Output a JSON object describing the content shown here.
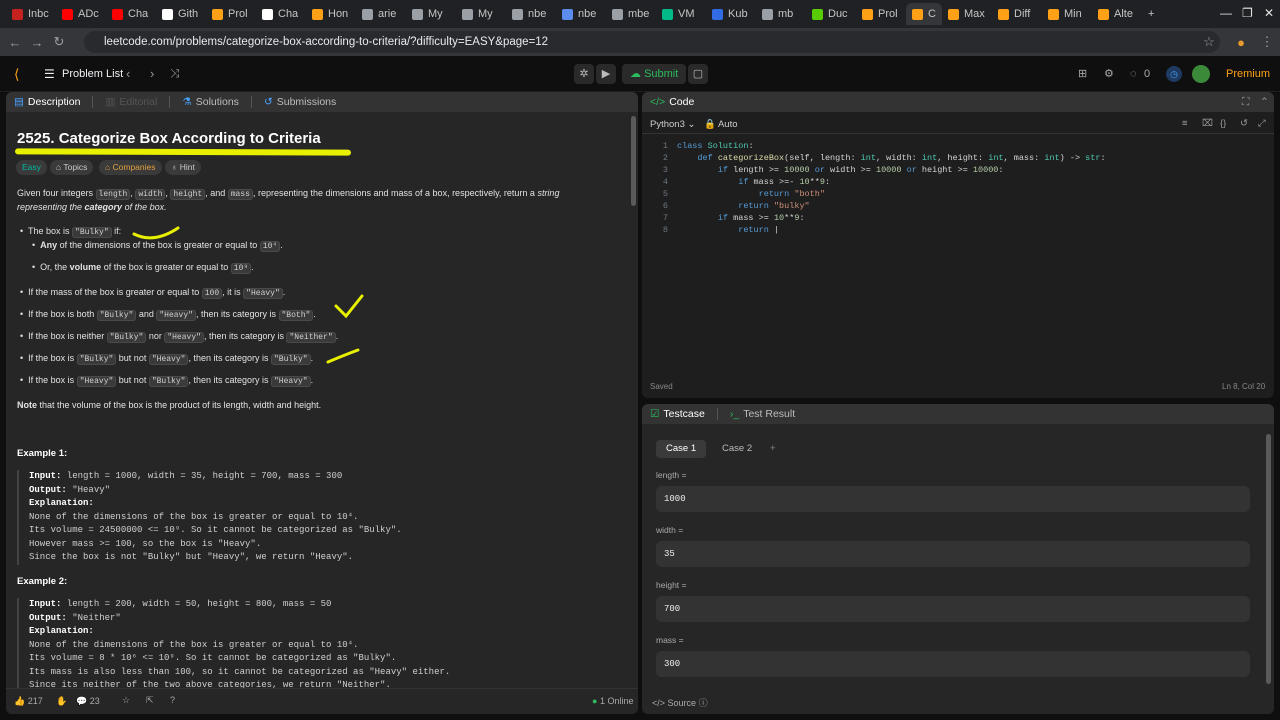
{
  "browser": {
    "tabs": [
      {
        "label": "Inbc",
        "color": "#c5221f"
      },
      {
        "label": "ADc",
        "color": "#ff0000"
      },
      {
        "label": "Cha",
        "color": "#ff0000"
      },
      {
        "label": "Gith",
        "color": "#ffffff"
      },
      {
        "label": "Prol",
        "color": "#ffa116"
      },
      {
        "label": "Cha",
        "color": "#ffffff"
      },
      {
        "label": "Hon",
        "color": "#ffa116"
      },
      {
        "label": "arie",
        "color": "#9aa0a6"
      },
      {
        "label": "My",
        "color": "#9aa0a6"
      },
      {
        "label": "My",
        "color": "#9aa0a6"
      },
      {
        "label": "nbe",
        "color": "#9aa0a6"
      },
      {
        "label": "nbe",
        "color": "#5b8def"
      },
      {
        "label": "mbe",
        "color": "#9aa0a6"
      },
      {
        "label": "VM",
        "color": "#0b8"
      },
      {
        "label": "Kub",
        "color": "#326ce5"
      },
      {
        "label": "mb",
        "color": "#9aa0a6"
      },
      {
        "label": "Duc",
        "color": "#58cc02"
      },
      {
        "label": "Prol",
        "color": "#ffa116"
      },
      {
        "label": "C",
        "color": "#ffa116"
      },
      {
        "label": "Max",
        "color": "#ffa116"
      },
      {
        "label": "Diff",
        "color": "#ffa116"
      },
      {
        "label": "Min",
        "color": "#ffa116"
      },
      {
        "label": "Alte",
        "color": "#ffa116"
      }
    ],
    "url": "leetcode.com/problems/categorize-box-according-to-criteria/?difficulty=EASY&page=12"
  },
  "nav": {
    "problem_list": "Problem List",
    "submit": "Submit",
    "streak": "0",
    "premium": "Premium"
  },
  "left": {
    "tabs": {
      "description": "Description",
      "editorial": "Editorial",
      "solutions": "Solutions",
      "submissions": "Submissions"
    },
    "title": "2525. Categorize Box According to Criteria",
    "chips": {
      "easy": "Easy",
      "topics": "Topics",
      "companies": "Companies",
      "hint": "Hint"
    },
    "intro": {
      "p1": "Given four integers ",
      "c1": "length",
      "s1": ", ",
      "c2": "width",
      "s2": ", ",
      "c3": "height",
      "s3": ", and ",
      "c4": "mass",
      "s4": ", representing the dimensions and mass of a box, respectively, return a ",
      "i1": "string",
      "line2a": "representing the ",
      "line2b": "category",
      "line2c": " of the box."
    },
    "rules": {
      "b1a": "The box is ",
      "b1c": "\"Bulky\"",
      "b1b": " if:",
      "s1a": "Any",
      "s1b": " of the dimensions of the box is greater or equal to ",
      "s1c": "10⁴",
      ".": ".",
      "s2a": "Or, the ",
      "s2b": "volume",
      "s2c": " of the box is greater or equal to ",
      "s2d": "10⁹",
      "b2a": "If the mass of the box is greater or equal to ",
      "b2b": "100",
      "b2c": ", it is ",
      "b2d": "\"Heavy\"",
      "b3a": "If the box is both ",
      "b3b": "\"Bulky\"",
      "b3c": " and ",
      "b3d": "\"Heavy\"",
      "b3e": ", then its category is ",
      "b3f": "\"Both\"",
      "b4a": "If the box is neither ",
      "b4b": "\"Bulky\"",
      "b4c": " nor ",
      "b4d": "\"Heavy\"",
      "b4e": ", then its category is ",
      "b4f": "\"Neither\"",
      "b5a": "If the box is ",
      "b5b": "\"Bulky\"",
      "b5c": " but not ",
      "b5d": "\"Heavy\"",
      "b5e": ", then its category is ",
      "b5f": "\"Bulky\"",
      "b6a": "If the box is ",
      "b6b": "\"Heavy\"",
      "b6c": " but not ",
      "b6d": "\"Bulky\"",
      "b6e": ", then its category is ",
      "b6f": "\"Heavy\""
    },
    "note_a": "Note",
    "note_b": " that the volume of the box is the product of its length, width and height.",
    "ex1": {
      "h": "Example 1:",
      "input": "length = 1000, width = 35, height = 700, mass = 300",
      "output": "\"Heavy\"",
      "exp": [
        "None of the dimensions of the box is greater or equal to 10⁴.",
        "Its volume = 24500000 <= 10⁹. So it cannot be categorized as \"Bulky\".",
        "However mass >= 100, so the box is \"Heavy\".",
        "Since the box is not \"Bulky\" but \"Heavy\", we return \"Heavy\"."
      ]
    },
    "ex2": {
      "h": "Example 2:",
      "input": "length = 200, width = 50, height = 800, mass = 50",
      "output": "\"Neither\"",
      "exp": [
        "None of the dimensions of the box is greater or equal to 10⁴.",
        "Its volume = 8 * 10⁶ <= 10⁹. So it cannot be categorized as \"Bulky\".",
        "Its mass is also less than 100, so it cannot be categorized as \"Heavy\" either.",
        "Since its neither of the two above categories, we return \"Neither\"."
      ]
    },
    "labels": {
      "input": "Input:",
      "output": "Output:",
      "explanation": "Explanation:"
    },
    "footer": {
      "likes": "217",
      "comments": "23",
      "online": "1 Online"
    }
  },
  "editor": {
    "tab": "Code",
    "lang": "Python3",
    "auto": "Auto",
    "saved": "Saved",
    "cursor": "Ln 8, Col 20"
  },
  "testcase": {
    "tab": "Testcase",
    "result_tab": "Test Result",
    "cases": [
      "Case 1",
      "Case 2"
    ],
    "fields": [
      {
        "label": "length =",
        "value": "1000"
      },
      {
        "label": "width =",
        "value": "35"
      },
      {
        "label": "height =",
        "value": "700"
      },
      {
        "label": "mass =",
        "value": "300"
      }
    ],
    "source": "Source"
  }
}
